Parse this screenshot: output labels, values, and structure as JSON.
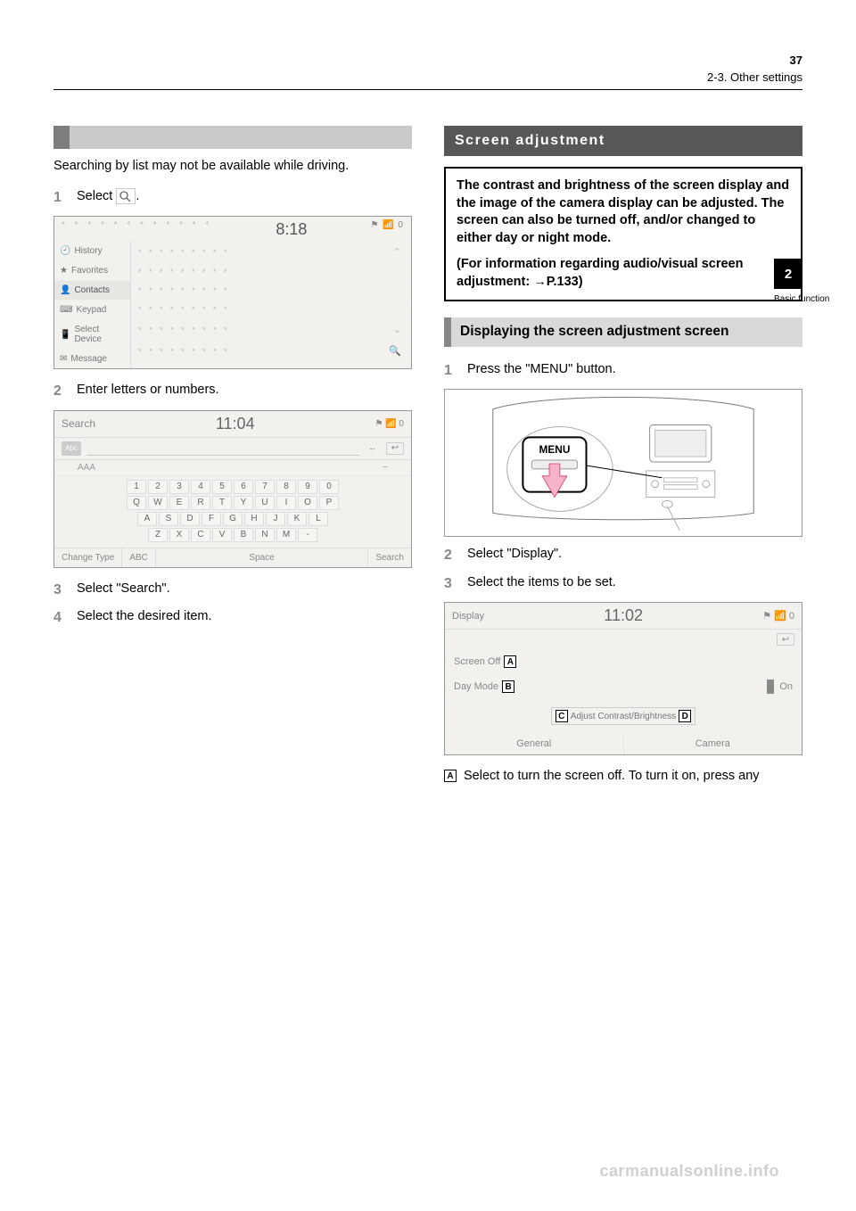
{
  "header": {
    "page_left": "",
    "page_right": "37",
    "section_left": "",
    "section_right": "2-3. Other settings"
  },
  "side_tab": {
    "number": "2",
    "label": "Basic function"
  },
  "left": {
    "intro": "Searching by list may not be available while driving.",
    "steps": {
      "1": "Select",
      "2": "Enter letters or numbers.",
      "3": "Select \"Search\".",
      "4": "Select the desired item."
    },
    "shot1": {
      "dots_top": "* * * * * * * * * * * *",
      "time": "8:18",
      "status_icons": "⚑ 📶 0",
      "sidebar": [
        {
          "icon": "🕘",
          "label": "History"
        },
        {
          "icon": "★",
          "label": "Favorites"
        },
        {
          "icon": "👤",
          "label": "Contacts",
          "active": true
        },
        {
          "icon": "⌨",
          "label": "Keypad"
        },
        {
          "icon": "📱",
          "label": "Select Device"
        },
        {
          "icon": "✉",
          "label": "Message"
        }
      ],
      "row_dots": "* * * * * * * * *",
      "chev_up": "⌃",
      "chev_down": "⌄",
      "search_icon": "🔍"
    },
    "shot2": {
      "title": "Search",
      "time": "11:04",
      "status_icons": "⚑ 📶 0",
      "input_value": "",
      "abc_tab": "Abc",
      "arrow_left": "←",
      "back": "↩",
      "suggest": "AAA",
      "suggest_dash": "~",
      "kb_rows": [
        [
          "1",
          "2",
          "3",
          "4",
          "5",
          "6",
          "7",
          "8",
          "9",
          "0"
        ],
        [
          "Q",
          "W",
          "E",
          "R",
          "T",
          "Y",
          "U",
          "I",
          "O",
          "P"
        ],
        [
          "A",
          "S",
          "D",
          "F",
          "G",
          "H",
          "J",
          "K",
          "L"
        ],
        [
          "Z",
          "X",
          "C",
          "V",
          "B",
          "N",
          "M",
          "-"
        ]
      ],
      "footer": {
        "change_type": "Change Type",
        "abc": "ABC",
        "space": "Space",
        "search": "Search"
      }
    }
  },
  "right": {
    "title": "Screen adjustment",
    "intro1": "The contrast and brightness of the screen display and the image of the camera display can be adjusted. The screen can also be turned off, and/or changed to either day or night mode.",
    "intro2a": "(For information regarding audio/visual screen adjustment: ",
    "intro2arrow": "→",
    "intro2b": "P.133)",
    "sub_heading": "Displaying the screen adjustment screen",
    "steps": {
      "1": "Press the \"MENU\" button.",
      "2": "Select \"Display\".",
      "3": "Select the items to be set."
    },
    "menu_button_label": "MENU",
    "disp": {
      "title": "Display",
      "time": "11:02",
      "status_icons": "⚑ 📶 0",
      "back": "↩",
      "row1": {
        "label": "Screen Off",
        "callout": "A"
      },
      "row2": {
        "label": "Day Mode",
        "callout": "B",
        "toggle": "On"
      },
      "adjust": {
        "callout_left": "C",
        "label": "Adjust Contrast/Brightness",
        "callout_right": "D"
      },
      "tabs": {
        "general": "General",
        "camera": "Camera"
      }
    },
    "callout_A": {
      "letter": "A",
      "text": "Select to turn the screen off. To turn it on, press any"
    }
  },
  "footer": {
    "url": "carmanualsonline.info"
  },
  "chart_data": null
}
